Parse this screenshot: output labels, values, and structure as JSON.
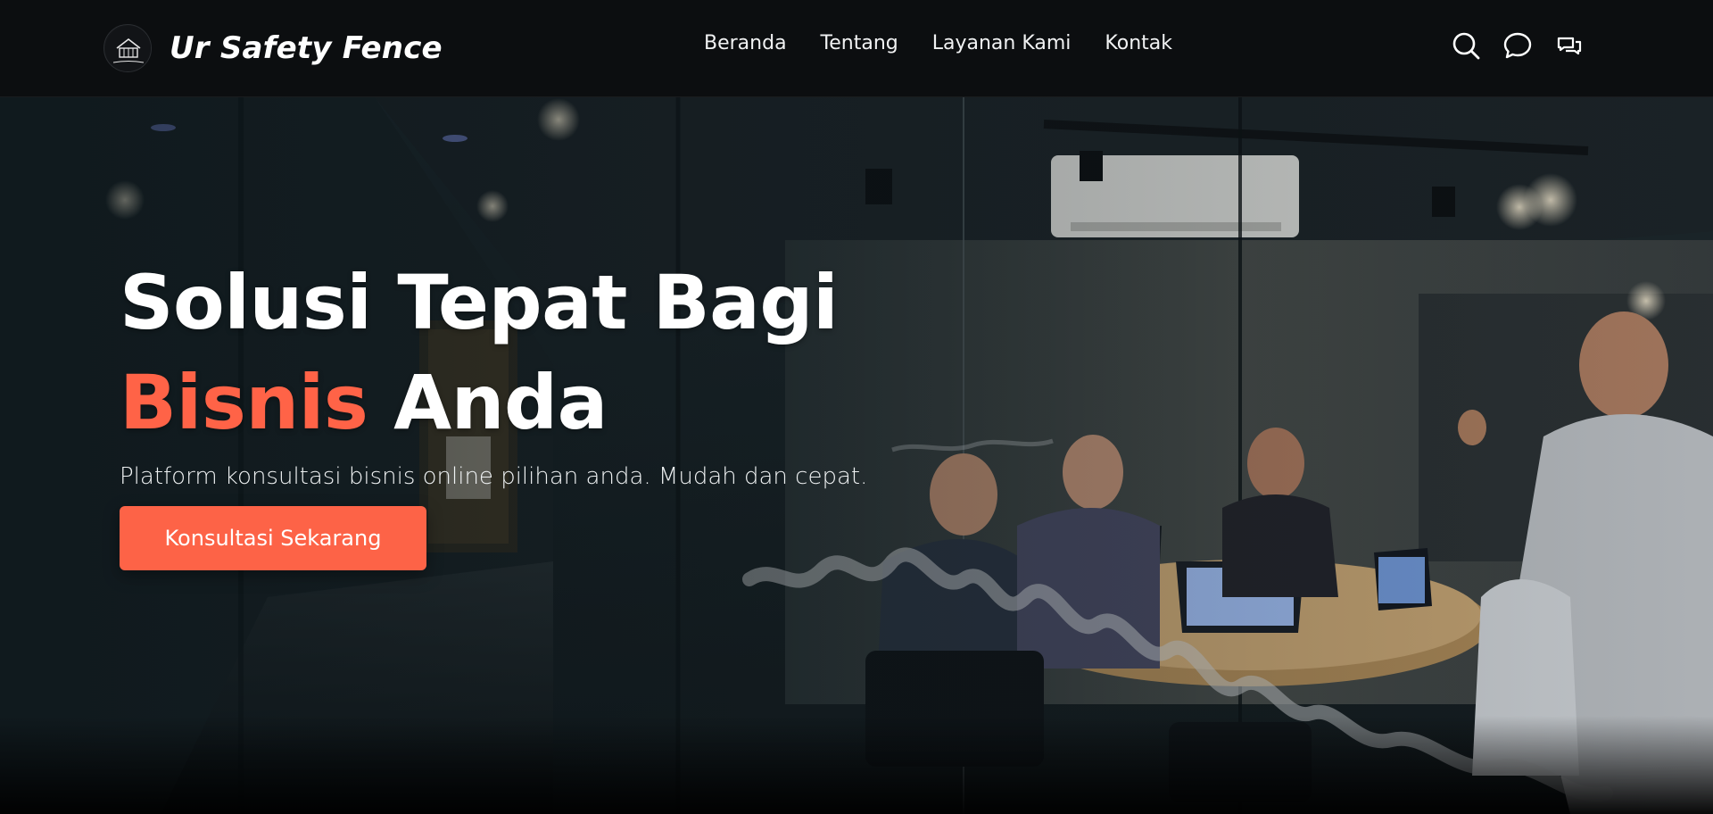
{
  "brand": {
    "name": "Ur Safety Fence",
    "logo_text": "Ur Safety Fence"
  },
  "nav": {
    "links": [
      {
        "label": "Beranda"
      },
      {
        "label": "Tentang"
      },
      {
        "label": "Layanan Kami"
      },
      {
        "label": "Kontak"
      }
    ],
    "icons": [
      "search-icon",
      "chat-bubble-icon",
      "messages-icon"
    ]
  },
  "hero": {
    "title_line1": "Solusi Tepat Bagi",
    "title_accent": "Bisnis",
    "title_line2_rest": "Anda",
    "subtitle": "Platform konsultasi bisnis online pilihan anda. Mudah dan cepat.",
    "cta_label": "Konsultasi Sekarang"
  },
  "colors": {
    "accent": "#ff6347",
    "navbar_bg": "#0c0e10",
    "text": "#ffffff"
  }
}
